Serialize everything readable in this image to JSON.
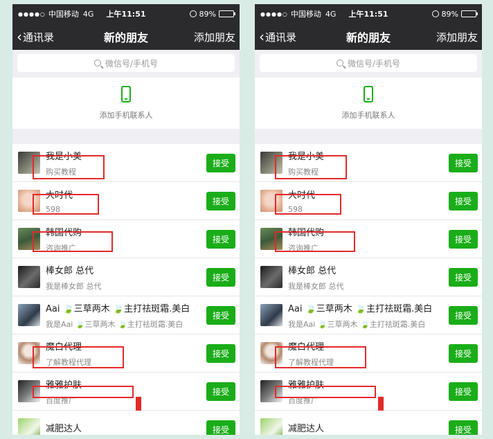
{
  "status": {
    "signal": "●●●●○",
    "carrier": "中国移动",
    "network": "4G",
    "time": "上午11:51",
    "battery": "89%",
    "battery_level": 0.89
  },
  "nav": {
    "back_label": "通讯录",
    "back_chevron": "‹",
    "title": "新的朋友",
    "add_label": "添加朋友"
  },
  "search": {
    "placeholder": "微信号/手机号"
  },
  "mobile_contacts": {
    "label": "添加手机联系人",
    "icon": "mobile-phone-icon"
  },
  "accept_label": "接受",
  "requests": [
    {
      "name": "我是小美",
      "message": "购买教程"
    },
    {
      "name": "大时代",
      "message": "598"
    },
    {
      "name": "韩国代购",
      "message": "咨询推广"
    },
    {
      "name": "棒女郎 总代",
      "message": "我是棒女郎 总代"
    },
    {
      "name": "Aai 🍃三草两木 🍃主打祛斑霜.美白",
      "message": "我是Aai 🍃三草两木 🍃主打祛斑霜.美白"
    },
    {
      "name": "魔白代理",
      "message": "了解教程代理"
    },
    {
      "name": "雅雅护肤",
      "message": "百度推广"
    },
    {
      "name": "减肥达人",
      "message": ""
    }
  ],
  "colors": {
    "nav_bg": "#2b2b2e",
    "accent_green": "#1aad19",
    "highlight_red": "#e22a2a",
    "page_bg": "#d8ebe5"
  }
}
